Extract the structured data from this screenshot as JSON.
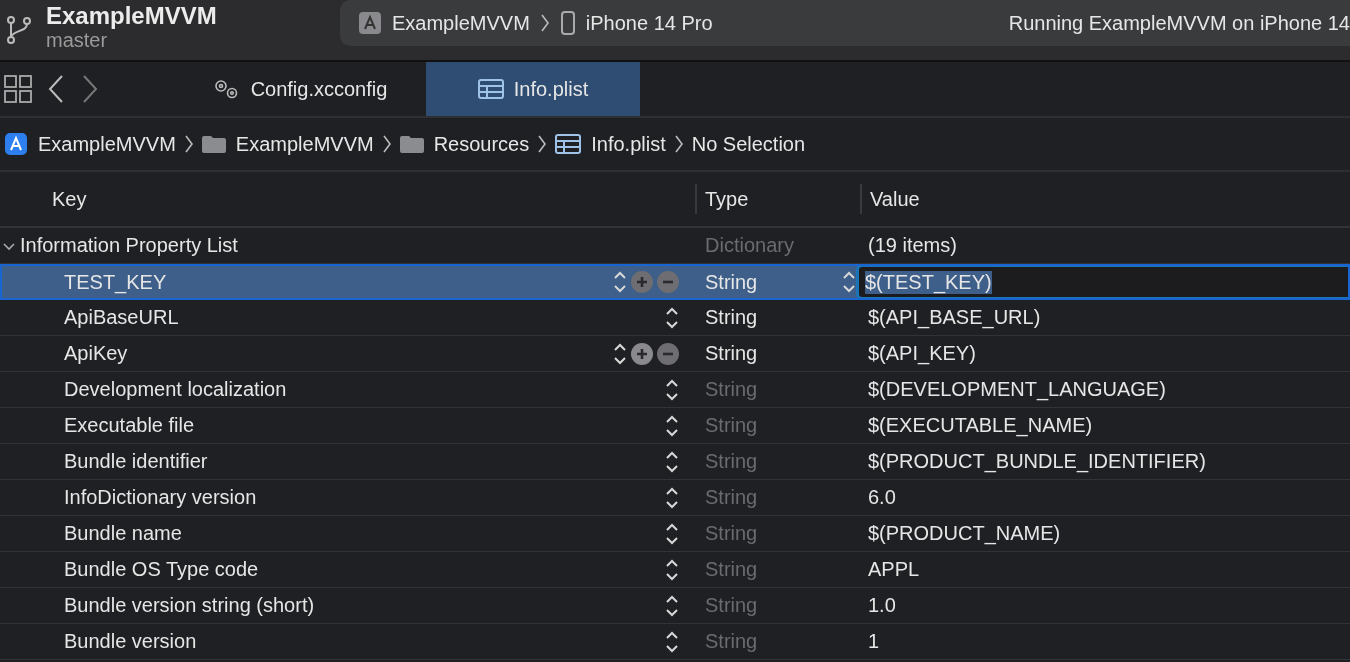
{
  "toolbar": {
    "project": "ExampleMVVM",
    "branch": "master",
    "scheme": "ExampleMVVM",
    "device": "iPhone 14 Pro",
    "status": "Running ExampleMVVM on iPhone 14"
  },
  "tabs": [
    {
      "label": "Config.xcconfig",
      "kind": "config",
      "selected": false
    },
    {
      "label": "Info.plist",
      "kind": "plist",
      "selected": true
    }
  ],
  "breadcrumb": [
    {
      "label": "ExampleMVVM",
      "kind": "project"
    },
    {
      "label": "ExampleMVVM",
      "kind": "folder"
    },
    {
      "label": "Resources",
      "kind": "folder"
    },
    {
      "label": "Info.plist",
      "kind": "plist"
    },
    {
      "label": "No Selection",
      "kind": "text"
    }
  ],
  "table": {
    "columns": [
      "Key",
      "Type",
      "Value"
    ],
    "rows": [
      {
        "kind": "root",
        "expanded": true,
        "key": "Information Property List",
        "type": "Dictionary",
        "value": "(19 items)",
        "selected": false,
        "type_disabled": true
      },
      {
        "kind": "item",
        "key": "TEST_KEY",
        "type": "String",
        "value": "$(TEST_KEY)",
        "selected": true,
        "hovered": true,
        "type_disabled": false
      },
      {
        "kind": "item",
        "key": "ApiBaseURL",
        "type": "String",
        "value": "$(API_BASE_URL)",
        "selected": false,
        "hovered": false,
        "type_disabled": false
      },
      {
        "kind": "item",
        "key": "ApiKey",
        "type": "String",
        "value": "$(API_KEY)",
        "selected": false,
        "hovered": true,
        "type_disabled": false
      },
      {
        "kind": "item",
        "key": "Development localization",
        "type": "String",
        "value": "$(DEVELOPMENT_LANGUAGE)",
        "selected": false,
        "hovered": false,
        "type_disabled": true
      },
      {
        "kind": "item",
        "key": "Executable file",
        "type": "String",
        "value": "$(EXECUTABLE_NAME)",
        "selected": false,
        "hovered": false,
        "type_disabled": true
      },
      {
        "kind": "item",
        "key": "Bundle identifier",
        "type": "String",
        "value": "$(PRODUCT_BUNDLE_IDENTIFIER)",
        "selected": false,
        "hovered": false,
        "type_disabled": true
      },
      {
        "kind": "item",
        "key": "InfoDictionary version",
        "type": "String",
        "value": "6.0",
        "selected": false,
        "hovered": false,
        "type_disabled": true
      },
      {
        "kind": "item",
        "key": "Bundle name",
        "type": "String",
        "value": "$(PRODUCT_NAME)",
        "selected": false,
        "hovered": false,
        "type_disabled": true
      },
      {
        "kind": "item",
        "key": "Bundle OS Type code",
        "type": "String",
        "value": "APPL",
        "selected": false,
        "hovered": false,
        "type_disabled": true
      },
      {
        "kind": "item",
        "key": "Bundle version string (short)",
        "type": "String",
        "value": "1.0",
        "selected": false,
        "hovered": false,
        "type_disabled": true
      },
      {
        "kind": "item",
        "key": "Bundle version",
        "type": "String",
        "value": "1",
        "selected": false,
        "hovered": false,
        "type_disabled": true
      }
    ]
  }
}
